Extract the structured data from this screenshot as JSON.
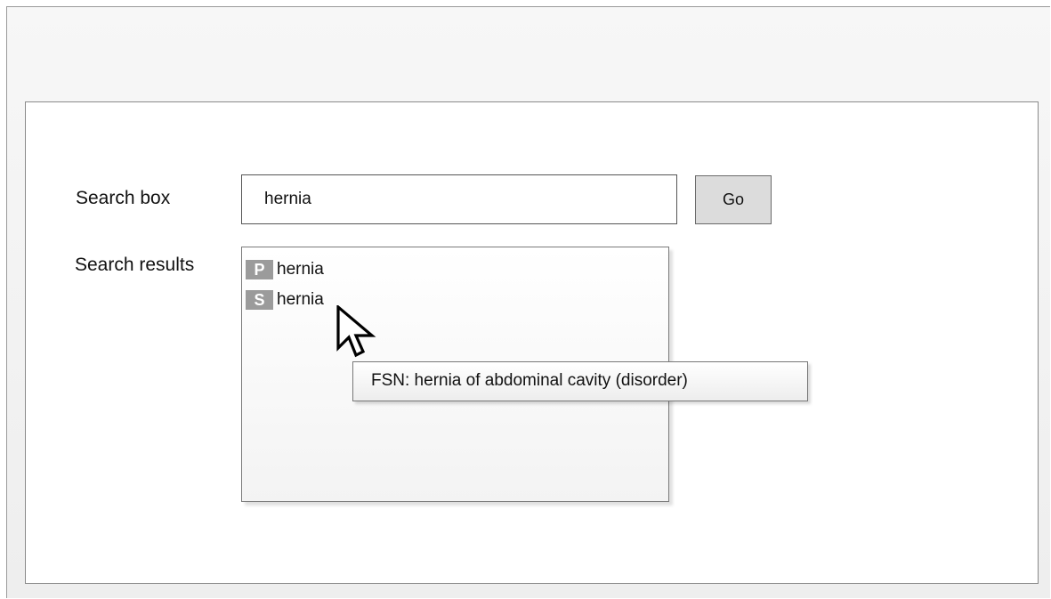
{
  "search": {
    "label": "Search box",
    "value": "hernia",
    "go_label": "Go"
  },
  "results": {
    "label": "Search results",
    "items": [
      {
        "badge": "P",
        "text": "hernia"
      },
      {
        "badge": "S",
        "text": "hernia"
      }
    ]
  },
  "tooltip": {
    "text": "FSN: hernia of abdominal cavity (disorder)"
  },
  "icons": {
    "cursor": "mouse-pointer-icon"
  },
  "colors": {
    "badge": "#9b9b9b",
    "button": "#dcdcdc"
  }
}
